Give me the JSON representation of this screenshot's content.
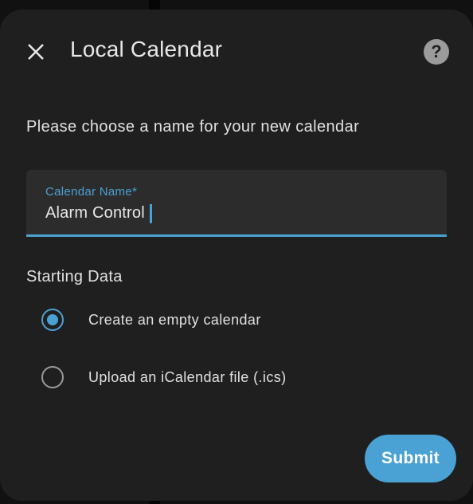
{
  "dialog": {
    "title": "Local Calendar",
    "close_icon": "close-icon",
    "help_icon": "help-circle-icon",
    "help_glyph": "?"
  },
  "form": {
    "description": "Please choose a name for your new calendar",
    "calendar_name": {
      "label": "Calendar Name*",
      "value": "Alarm Control"
    },
    "starting_data": {
      "title": "Starting Data",
      "options": [
        {
          "label": "Create an empty calendar",
          "checked": true
        },
        {
          "label": "Upload an iCalendar file (.ics)",
          "checked": false
        }
      ]
    },
    "submit_label": "Submit"
  },
  "colors": {
    "accent": "#4aa1d3",
    "dialog_bg": "#1f1f1f",
    "field_bg": "#2c2c2c",
    "text": "#e1e1e1"
  }
}
